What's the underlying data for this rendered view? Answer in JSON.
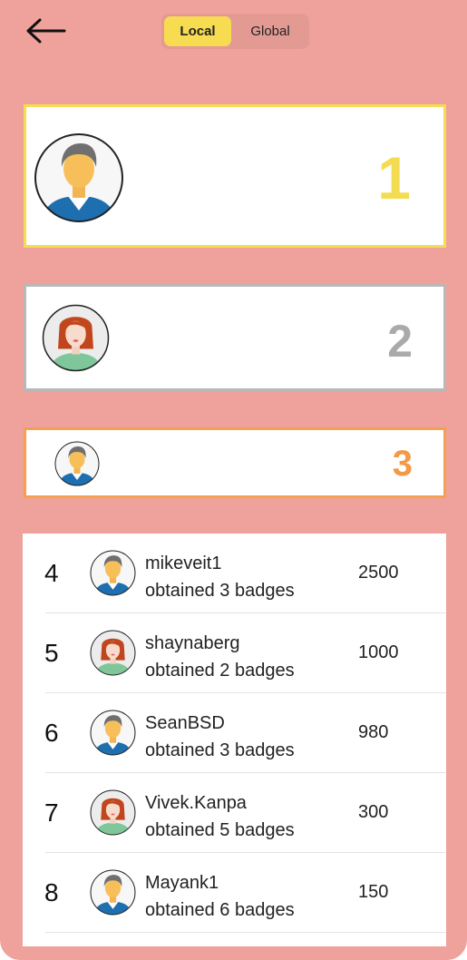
{
  "nav": {
    "back_icon": "arrow-left-icon",
    "tabs": [
      {
        "label": "Local",
        "active": true
      },
      {
        "label": "Global",
        "active": false
      }
    ]
  },
  "podium": [
    {
      "rank": "1",
      "avatar": "male-avatar",
      "border_color": "#f5dc55"
    },
    {
      "rank": "2",
      "avatar": "female-avatar",
      "border_color": "#b8b8b8"
    },
    {
      "rank": "3",
      "avatar": "male-avatar",
      "border_color": "#f4a050"
    }
  ],
  "leaderboard": [
    {
      "rank": "4",
      "name": "mikeveit1",
      "badges": "obtained 3 badges",
      "score": "2500",
      "avatar": "male-avatar"
    },
    {
      "rank": "5",
      "name": "shaynaberg",
      "badges": "obtained 2 badges",
      "score": "1000",
      "avatar": "female-avatar"
    },
    {
      "rank": "6",
      "name": "SeanBSD",
      "badges": "obtained 3 badges",
      "score": "980",
      "avatar": "male-avatar"
    },
    {
      "rank": "7",
      "name": "Vivek.Kanpa",
      "badges": "obtained 5 badges",
      "score": "300",
      "avatar": "female-avatar"
    },
    {
      "rank": "8",
      "name": "Mayank1",
      "badges": "obtained 6 badges",
      "score": "150",
      "avatar": "male-avatar"
    }
  ],
  "colors": {
    "background": "#eea29b",
    "active_tab": "#f7dc52",
    "gold": "#f4dc52",
    "silver": "#aaaaaa",
    "bronze": "#f29a48"
  }
}
